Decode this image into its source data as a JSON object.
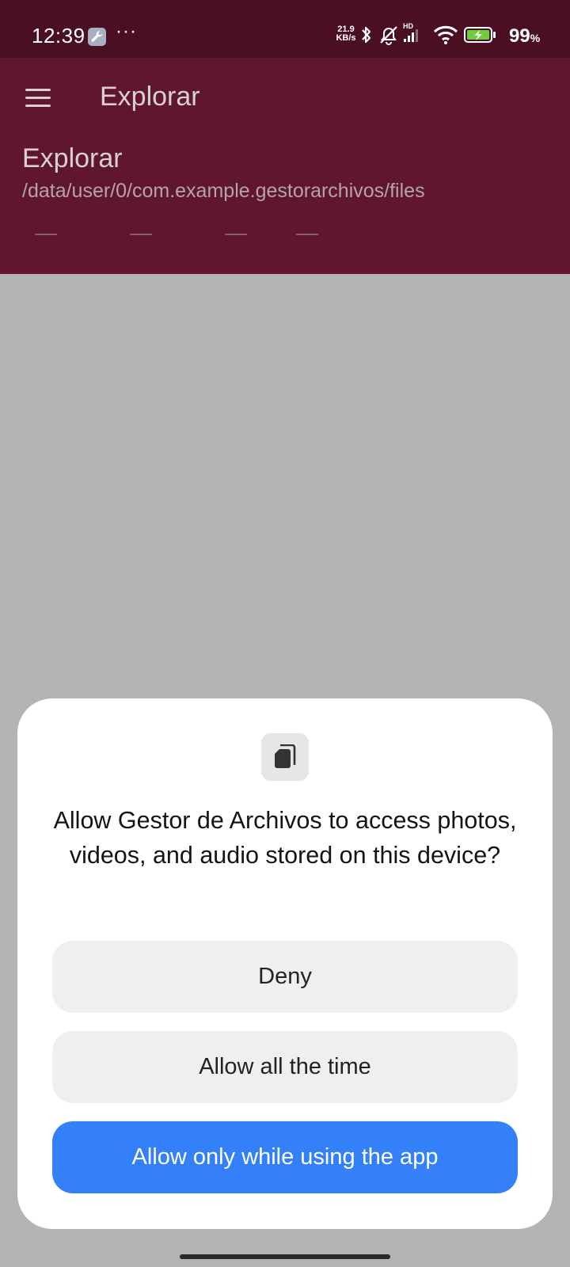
{
  "status_bar": {
    "time": "12:39",
    "more_indicator": "···",
    "net_speed_value": "21.9",
    "net_speed_unit": "KB/s",
    "signal_tag": "HD",
    "battery_percent": "99",
    "battery_percent_sign": "%",
    "icons": [
      "wrench-icon",
      "bluetooth-icon",
      "alarm-off-icon",
      "signal-icon",
      "wifi-icon",
      "battery-charging-icon"
    ],
    "battery_color": "#6ccf3a"
  },
  "app_bar": {
    "title": "Explorar",
    "menu_icon": "hamburger-menu-icon",
    "background_color": "#60162d"
  },
  "content": {
    "section_title": "Explorar",
    "section_path": "/data/user/0/com.example.gestorarchivos/files"
  },
  "permission_dialog": {
    "icon": "file-copy-icon",
    "message": "Allow Gestor de Archivos to access photos, videos, and audio stored on this device?",
    "buttons": {
      "deny": "Deny",
      "allow_all": "Allow all the time",
      "allow_while_using": "Allow only while using the app"
    },
    "primary_color": "#3380f8"
  }
}
